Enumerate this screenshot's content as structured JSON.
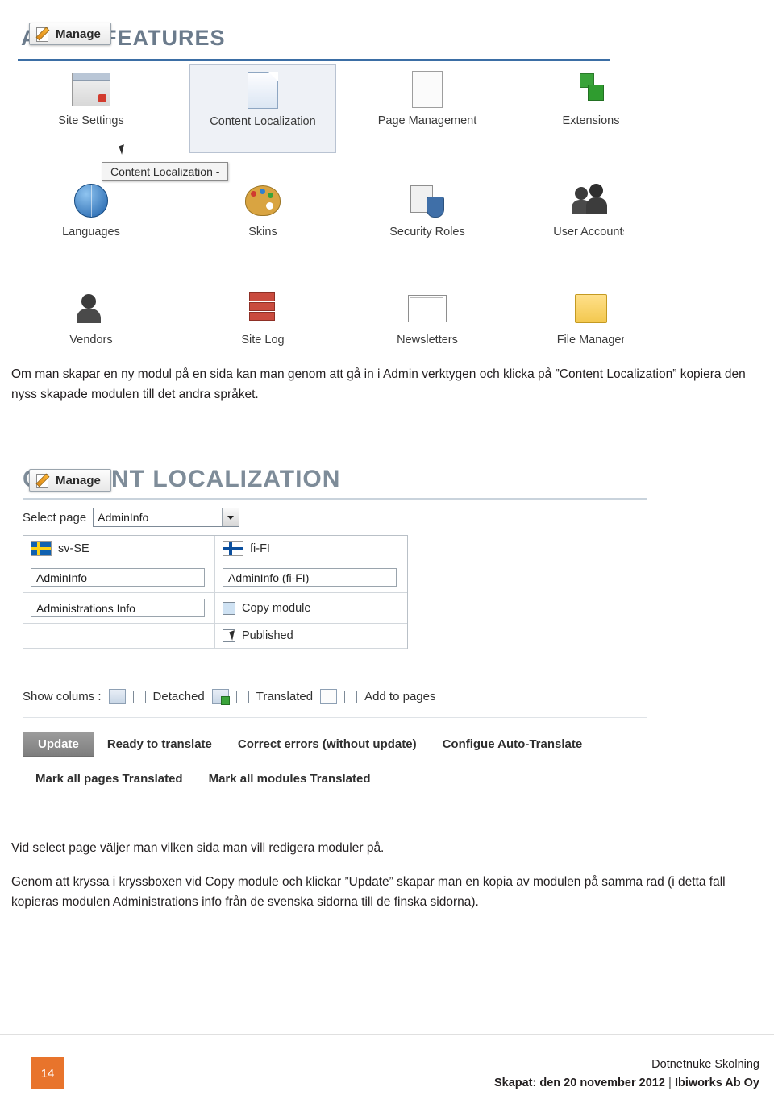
{
  "screenshot_admin": {
    "title": "ADMIN FEATURES",
    "manage_button": "Manage",
    "tooltip": "Content Localization -",
    "features": [
      {
        "label": "Site Settings",
        "icon": "site-settings-icon"
      },
      {
        "label": "Content Localization",
        "icon": "content-localization-icon"
      },
      {
        "label": "Page Management",
        "icon": "page-management-icon"
      },
      {
        "label": "Extensions",
        "icon": "extensions-icon"
      },
      {
        "label": "Languages",
        "icon": "languages-icon"
      },
      {
        "label": "Skins",
        "icon": "skins-icon"
      },
      {
        "label": "Security Roles",
        "icon": "security-roles-icon"
      },
      {
        "label": "User Accounts",
        "icon": "user-accounts-icon"
      },
      {
        "label": "Vendors",
        "icon": "vendors-icon"
      },
      {
        "label": "Site Log",
        "icon": "site-log-icon"
      },
      {
        "label": "Newsletters",
        "icon": "newsletters-icon"
      },
      {
        "label": "File Manager",
        "icon": "file-manager-icon"
      }
    ]
  },
  "paragraphs": {
    "p1": "Om man skapar en ny modul på en sida kan man genom att gå in i Admin verktygen och klicka på ”Content Localization” kopiera den nyss skapade modulen till det andra språket.",
    "p2": "Vid select page väljer man vilken sida man vill redigera moduler på.",
    "p3": "Genom att kryssa i kryssboxen vid Copy module och klickar ”Update” skapar man en kopia av modulen på samma rad (i detta fall kopieras modulen Administrations info från de svenska sidorna till de finska sidorna)."
  },
  "screenshot_localization": {
    "title": "CONTENT LOCALIZATION",
    "manage_button": "Manage",
    "select_page_label": "Select page",
    "select_page_value": "AdminInfo",
    "columns": [
      {
        "flag": "sv-SE-flag",
        "lang": "sv-SE"
      },
      {
        "flag": "fi-FI-flag",
        "lang": "fi-FI"
      }
    ],
    "row_module_names": [
      "AdminInfo",
      "AdminInfo (fi-FI)"
    ],
    "row_module_second": [
      "Administrations Info",
      ""
    ],
    "copy_module_label": "Copy module",
    "published_label": "Published",
    "show_columns_label": "Show colums :",
    "show_columns_options": [
      "Detached",
      "Translated",
      "Add to pages"
    ],
    "buttons_row1": [
      "Update",
      "Ready to translate",
      "Correct errors (without update)",
      "Configue Auto-Translate"
    ],
    "buttons_row2": [
      "Mark all pages Translated",
      "Mark all modules Translated"
    ]
  },
  "footer": {
    "page_number": "14",
    "line1": "Dotnetnuke Skolning",
    "line2_left": "Skapat: den 20 november 2012",
    "line2_right": "Ibiworks Ab Oy",
    "accent_color": "#e8742c"
  }
}
